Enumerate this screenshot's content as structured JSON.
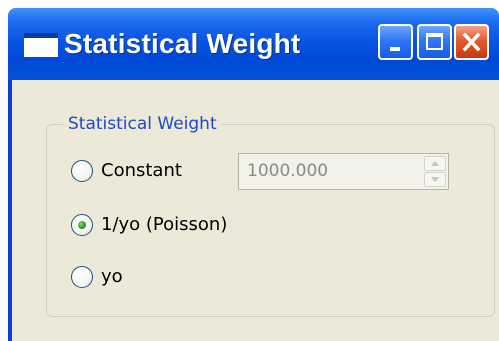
{
  "window": {
    "title": "Statistical Weight"
  },
  "group": {
    "title": "Statistical Weight"
  },
  "options": [
    {
      "label": "Constant",
      "selected": false
    },
    {
      "label": "1/yo (Poisson)",
      "selected": true
    },
    {
      "label": "yo",
      "selected": false
    }
  ],
  "constant_field": {
    "value": "1000.000",
    "enabled": false
  },
  "icons": {
    "window": "window-icon",
    "minimize": "minimize-icon",
    "maximize": "maximize-icon",
    "close": "close-icon",
    "spin_up": "spin-up-icon",
    "spin_down": "spin-down-icon"
  },
  "colors": {
    "title_bar": "#0049d8",
    "group_title": "#1f49c9",
    "client_bg": "#ece9d8",
    "close_button": "#e45a2e",
    "radio_selected": "#2f9a26"
  }
}
